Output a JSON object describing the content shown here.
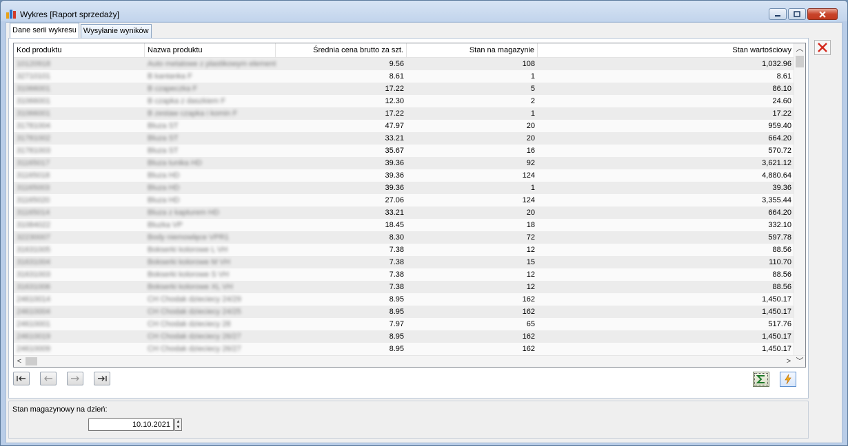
{
  "window": {
    "title": "Wykres [Raport sprzedaży]",
    "accent_close": "#c8442b"
  },
  "tabs": [
    {
      "label": "Dane serii wykresu",
      "active": true
    },
    {
      "label": "Wysyłanie wyników",
      "active": false
    }
  ],
  "table": {
    "columns": [
      "Kod produktu",
      "Nazwa produktu",
      "Średnia cena brutto za szt.",
      "Stan na magazynie",
      "Stan wartościowy"
    ],
    "rows": [
      [
        "10120918",
        "Auto metalowe z plastikowym elementem",
        "9.56",
        "108",
        "1,032.96"
      ],
      [
        "32710101",
        "B kantanka F",
        "8.61",
        "1",
        "8.61"
      ],
      [
        "31066001",
        "B czapeczka F",
        "17.22",
        "5",
        "86.10"
      ],
      [
        "31066001",
        "B czapka z daszkiem F",
        "12.30",
        "2",
        "24.60"
      ],
      [
        "31066001",
        "B zestaw czapka i komin F",
        "17.22",
        "1",
        "17.22"
      ],
      [
        "31781004",
        "Bluza ST",
        "47.97",
        "20",
        "959.40"
      ],
      [
        "31781002",
        "Bluza ST",
        "33.21",
        "20",
        "664.20"
      ],
      [
        "31781003",
        "Bluza ST",
        "35.67",
        "16",
        "570.72"
      ],
      [
        "31165017",
        "Bluza tunika HD",
        "39.36",
        "92",
        "3,621.12"
      ],
      [
        "31165018",
        "Bluza HD",
        "39.36",
        "124",
        "4,880.64"
      ],
      [
        "31165003",
        "Bluza HD",
        "39.36",
        "1",
        "39.36"
      ],
      [
        "31165020",
        "Bluza HD",
        "27.06",
        "124",
        "3,355.44"
      ],
      [
        "31165014",
        "Bluza z kapturem HD",
        "33.21",
        "20",
        "664.20"
      ],
      [
        "31084022",
        "Bluzka VP",
        "18.45",
        "18",
        "332.10"
      ],
      [
        "32230007",
        "Body niemowlęce VPR1",
        "8.30",
        "72",
        "597.78"
      ],
      [
        "31631005",
        "Bokserki kolorowe L VH",
        "7.38",
        "12",
        "88.56"
      ],
      [
        "31631004",
        "Bokserki kolorowe M VH",
        "7.38",
        "15",
        "110.70"
      ],
      [
        "31631003",
        "Bokserki kolorowe S VH",
        "7.38",
        "12",
        "88.56"
      ],
      [
        "31631006",
        "Bokserki kolorowe XL VH",
        "7.38",
        "12",
        "88.56"
      ],
      [
        "24610014",
        "CH Chodak dzieciecy 24/29",
        "8.95",
        "162",
        "1,450.17"
      ],
      [
        "24610004",
        "CH Chodak dzieciecy 24/25",
        "8.95",
        "162",
        "1,450.17"
      ],
      [
        "24610001",
        "CH Chodak dzieciecy 28",
        "7.97",
        "65",
        "517.76"
      ],
      [
        "24610019",
        "CH Chodak dzieciecy 26/27",
        "8.95",
        "162",
        "1,450.17"
      ],
      [
        "24610009",
        "CH Chodak dzieciecy 26/27",
        "8.95",
        "162",
        "1,450.17"
      ]
    ]
  },
  "footer": {
    "date_label": "Stan magazynowy na dzień:",
    "date_value": "10.10.2021"
  },
  "icons": {
    "nav": [
      "first-record-icon",
      "previous-record-icon",
      "next-record-icon",
      "last-record-icon"
    ],
    "actions": [
      "sum-icon",
      "refresh-icon"
    ],
    "side": "close-x-icon"
  }
}
